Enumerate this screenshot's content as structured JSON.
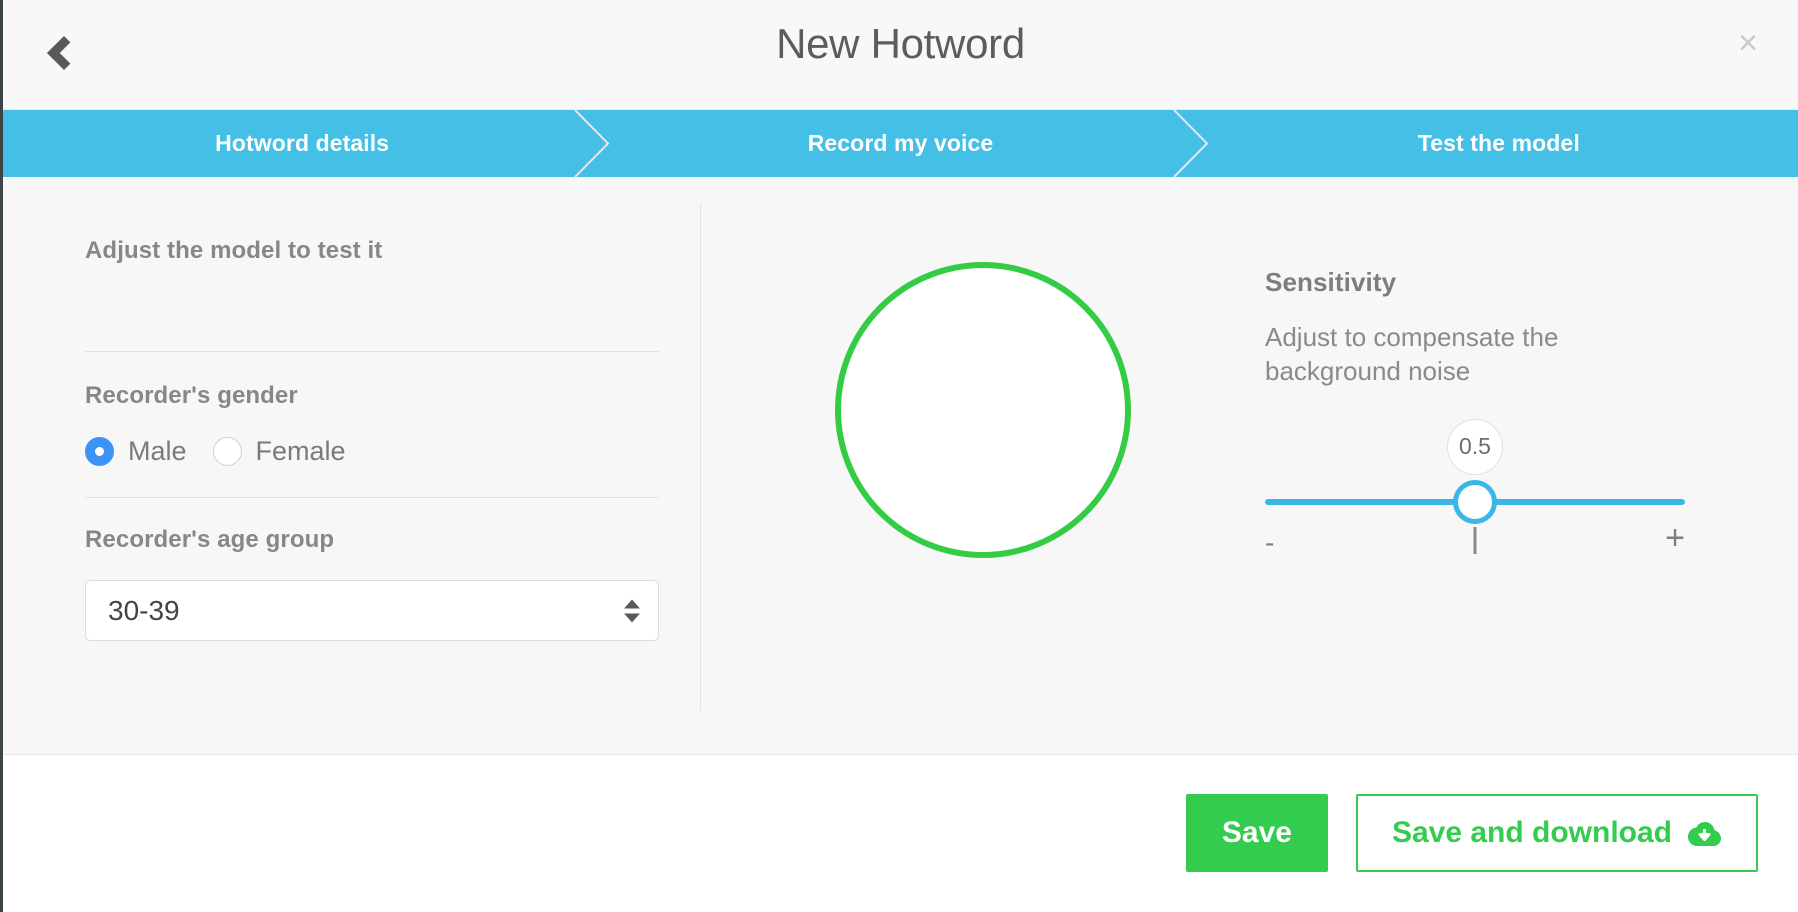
{
  "header": {
    "title": "New Hotword",
    "back_icon": "chevron-left-icon",
    "close_label": "×"
  },
  "steps": [
    {
      "label": "Hotword details",
      "active": true
    },
    {
      "label": "Record my voice",
      "active": true
    },
    {
      "label": "Test the model",
      "active": true
    }
  ],
  "left_pane": {
    "section_title": "Adjust the model to test it",
    "gender": {
      "label": "Recorder's gender",
      "options": [
        {
          "label": "Male",
          "selected": true
        },
        {
          "label": "Female",
          "selected": false
        }
      ]
    },
    "age_group": {
      "label": "Recorder's age group",
      "value": "30-39",
      "stepper_up_icon": "triangle-up-icon",
      "stepper_down_icon": "triangle-down-icon"
    }
  },
  "right_pane": {
    "voice_indicator_icon": "voice-level-circle-icon",
    "sensitivity": {
      "title": "Sensitivity",
      "description": "Adjust to compensate the background noise",
      "value": "0.5",
      "min_label": "-",
      "max_label": "+"
    }
  },
  "footer": {
    "save_label": "Save",
    "save_download_label": "Save and download",
    "download_icon": "cloud-download-icon"
  },
  "colors": {
    "step_bar": "#44bfe6",
    "accent_blue": "#3ab7e6",
    "radio_blue": "#3d93f5",
    "green": "#33cc4e",
    "circle_green": "#33cc44",
    "body_bg": "#f7f7f7",
    "header_bg": "#f8f8f8"
  }
}
